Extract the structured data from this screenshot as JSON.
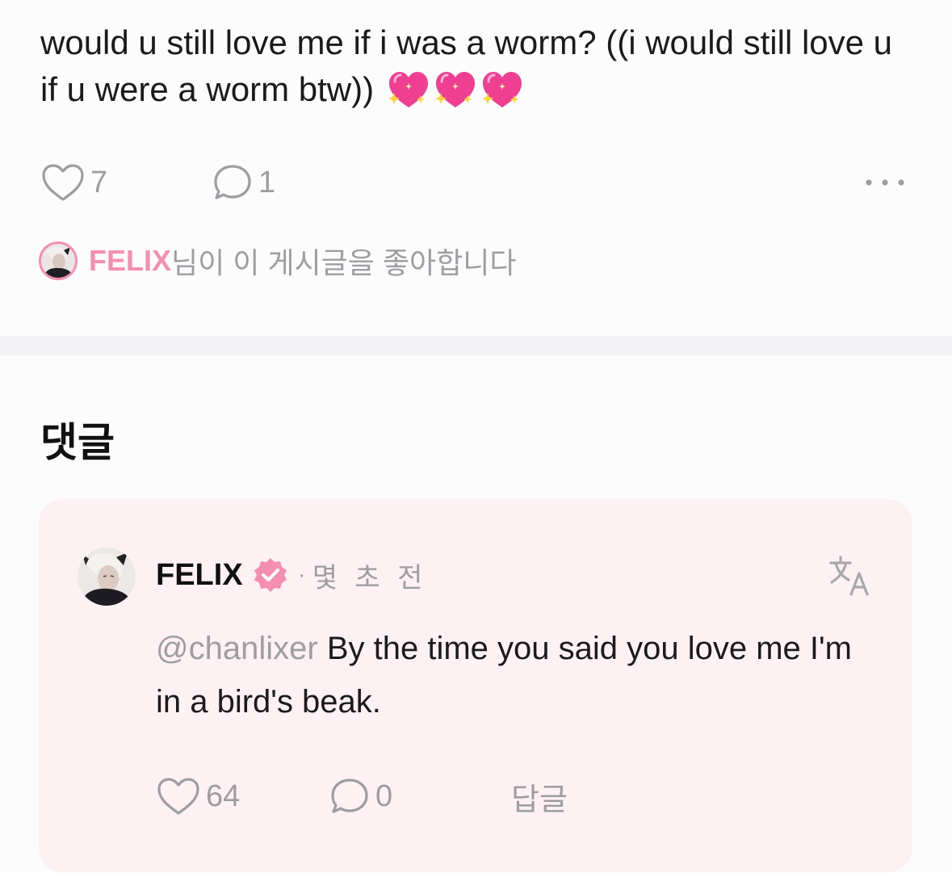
{
  "post": {
    "text": "would u still love me if i was a worm? ((i would still love u if u were a worm btw))",
    "emoji": [
      "sparkling-heart",
      "sparkling-heart",
      "sparkling-heart"
    ],
    "likes": "7",
    "comments": "1",
    "liked_by": {
      "name": "FELIX",
      "suffix": "님이 이 게시글을 좋아합니다"
    }
  },
  "comments_section": {
    "title": "댓글",
    "comment": {
      "author": "FELIX",
      "time": "몇 초 전",
      "mention": "@chanlixer",
      "text": "By the time you said you love me I'm in a bird's beak.",
      "likes": "64",
      "replies": "0",
      "reply_label": "답글"
    }
  },
  "colors": {
    "accent_pink": "#f48fb1",
    "muted": "#9d9da2",
    "card_bg": "#fdf1f3"
  }
}
